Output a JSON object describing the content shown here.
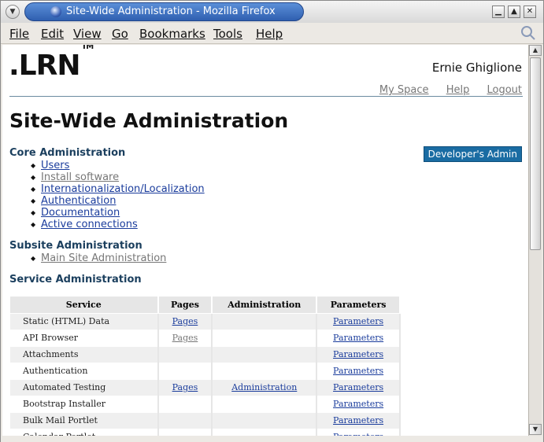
{
  "window": {
    "title": "Site-Wide Administration - Mozilla Firefox"
  },
  "menu": [
    "File",
    "Edit",
    "View",
    "Go",
    "Bookmarks",
    "Tools",
    "Help"
  ],
  "page": {
    "logo": ".LRN",
    "logo_tm": "TM",
    "user": "Ernie Ghiglione",
    "toplinks": [
      "My Space",
      "Help",
      "Logout"
    ],
    "title": "Site-Wide Administration",
    "dev_admin": "Developer's Admin",
    "core_heading": "Core Administration",
    "core_links": [
      {
        "label": "Users",
        "visited": false
      },
      {
        "label": "Install software",
        "visited": true
      },
      {
        "label": "Internationalization/Localization",
        "visited": false
      },
      {
        "label": "Authentication",
        "visited": false
      },
      {
        "label": "Documentation",
        "visited": false
      },
      {
        "label": "Active connections",
        "visited": false
      }
    ],
    "subsite_heading": "Subsite Administration",
    "subsite_links": [
      {
        "label": "Main Site Administration",
        "visited": true
      }
    ],
    "service_heading": "Service Administration",
    "table": {
      "headers": [
        "Service",
        "Pages",
        "Administration",
        "Parameters"
      ],
      "rows": [
        {
          "service": "Static (HTML) Data",
          "pages": "Pages",
          "admin": "",
          "params": "Parameters"
        },
        {
          "service": "API Browser",
          "pages": "Pages",
          "admin": "",
          "params": "Parameters"
        },
        {
          "service": "Attachments",
          "pages": "",
          "admin": "",
          "params": "Parameters"
        },
        {
          "service": "Authentication",
          "pages": "",
          "admin": "",
          "params": "Parameters"
        },
        {
          "service": "Automated Testing",
          "pages": "Pages",
          "admin": "Administration",
          "params": "Parameters"
        },
        {
          "service": "Bootstrap Installer",
          "pages": "",
          "admin": "",
          "params": "Parameters"
        },
        {
          "service": "Bulk Mail Portlet",
          "pages": "",
          "admin": "",
          "params": "Parameters"
        },
        {
          "service": "Calendar Portlet",
          "pages": "",
          "admin": "",
          "params": "Parameters"
        }
      ]
    }
  }
}
